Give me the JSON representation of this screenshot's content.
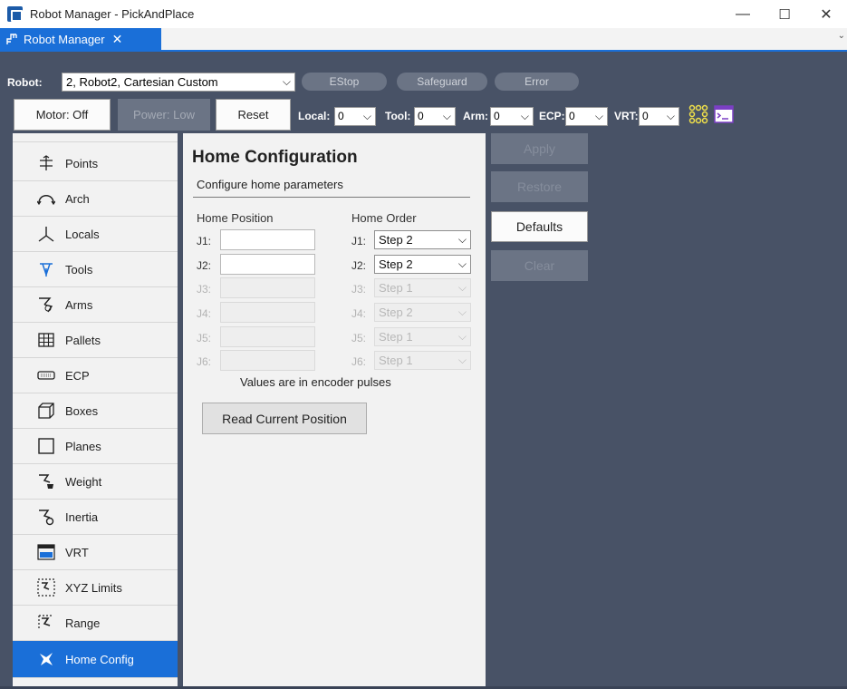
{
  "window": {
    "title": "Robot Manager - PickAndPlace",
    "minimize_glyph": "—",
    "maximize_glyph": "☐",
    "close_glyph": "✕"
  },
  "tab": {
    "label": "Robot Manager",
    "close_glyph": "✕",
    "overflow_glyph": "⌄"
  },
  "toolbar": {
    "robot_label": "Robot:",
    "robot_value": "2, Robot2, Cartesian Custom",
    "status": {
      "estop": "EStop",
      "safeguard": "Safeguard",
      "error": "Error"
    },
    "motor_label": "Motor: Off",
    "power_label": "Power: Low",
    "reset_label": "Reset",
    "local_label": "Local:",
    "local_value": "0",
    "tool_label": "Tool:",
    "tool_value": "0",
    "arm_label": "Arm:",
    "arm_value": "0",
    "ecp_label": "ECP:",
    "ecp_value": "0",
    "vrt_label": "VRT:",
    "vrt_value": "0"
  },
  "sidebar": {
    "items": [
      {
        "label": "Points",
        "icon": "points-icon"
      },
      {
        "label": "Arch",
        "icon": "arch-icon"
      },
      {
        "label": "Locals",
        "icon": "locals-icon"
      },
      {
        "label": "Tools",
        "icon": "tools-icon"
      },
      {
        "label": "Arms",
        "icon": "arms-icon"
      },
      {
        "label": "Pallets",
        "icon": "pallets-icon"
      },
      {
        "label": "ECP",
        "icon": "ecp-icon"
      },
      {
        "label": "Boxes",
        "icon": "boxes-icon"
      },
      {
        "label": "Planes",
        "icon": "planes-icon"
      },
      {
        "label": "Weight",
        "icon": "weight-icon"
      },
      {
        "label": "Inertia",
        "icon": "inertia-icon"
      },
      {
        "label": "VRT",
        "icon": "vrt-icon"
      },
      {
        "label": "XYZ Limits",
        "icon": "xyz-limits-icon"
      },
      {
        "label": "Range",
        "icon": "range-icon"
      },
      {
        "label": "Home Config",
        "icon": "home-config-icon",
        "active": true
      }
    ]
  },
  "panel": {
    "title": "Home Configuration",
    "subtitle": "Configure home parameters",
    "home_position_header": "Home Position",
    "home_order_header": "Home Order",
    "joints": [
      {
        "label": "J1:",
        "position": "",
        "order": "Step 2",
        "enabled": true
      },
      {
        "label": "J2:",
        "position": "",
        "order": "Step 2",
        "enabled": true
      },
      {
        "label": "J3:",
        "position": "",
        "order": "Step 1",
        "enabled": false
      },
      {
        "label": "J4:",
        "position": "",
        "order": "Step 2",
        "enabled": false
      },
      {
        "label": "J5:",
        "position": "",
        "order": "Step 1",
        "enabled": false
      },
      {
        "label": "J6:",
        "position": "",
        "order": "Step 1",
        "enabled": false
      }
    ],
    "note": "Values are in encoder pulses",
    "read_button": "Read Current Position"
  },
  "actions": {
    "apply": "Apply",
    "restore": "Restore",
    "defaults": "Defaults",
    "clear": "Clear"
  },
  "colors": {
    "accent": "#1a6fd8",
    "background_dark": "#485266",
    "disabled_button": "#6b7485"
  }
}
